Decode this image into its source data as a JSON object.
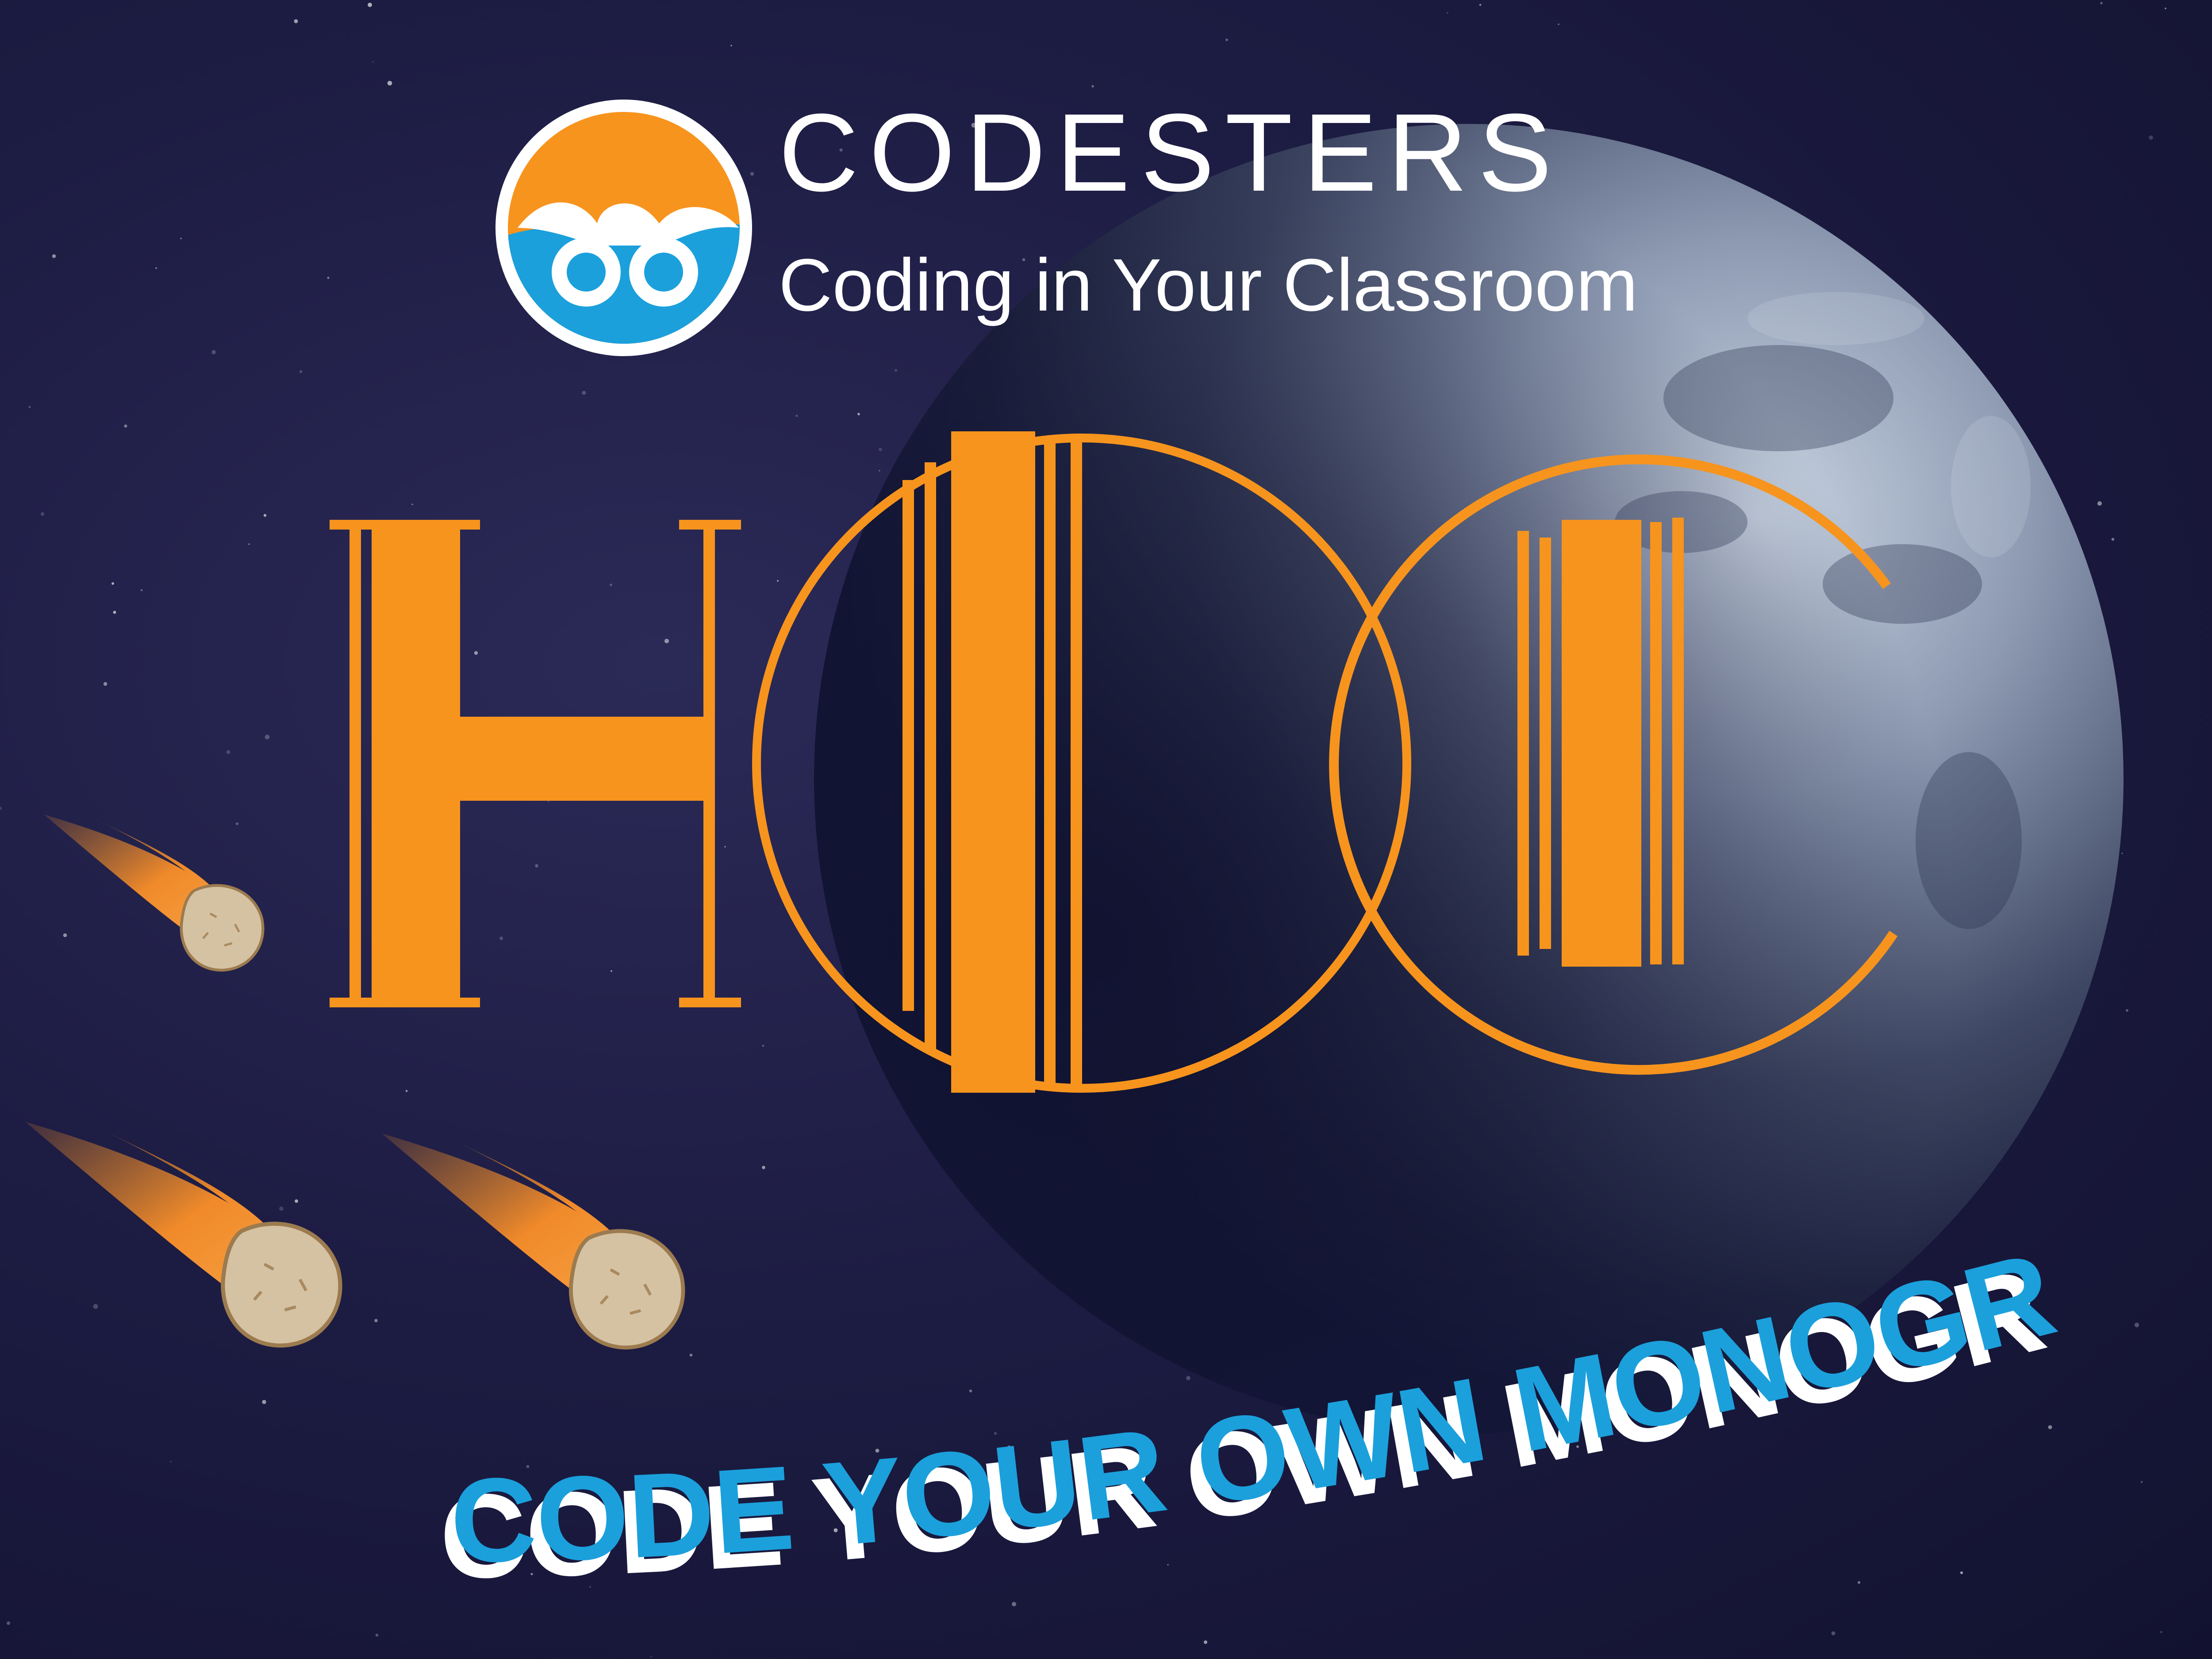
{
  "brand": {
    "name": "CODESTERS",
    "tagline": "Coding in Your Classroom"
  },
  "monogram": {
    "letters": [
      "H",
      "O",
      "C"
    ]
  },
  "slogan": "CODE YOUR OWN MONOGRAM!",
  "colors": {
    "orange": "#f7941d",
    "blue": "#1ba0dc",
    "background": "#1d1c43",
    "white": "#ffffff"
  },
  "icons": [
    "codesters-owl-logo-icon",
    "meteor-icon",
    "planet-image"
  ]
}
